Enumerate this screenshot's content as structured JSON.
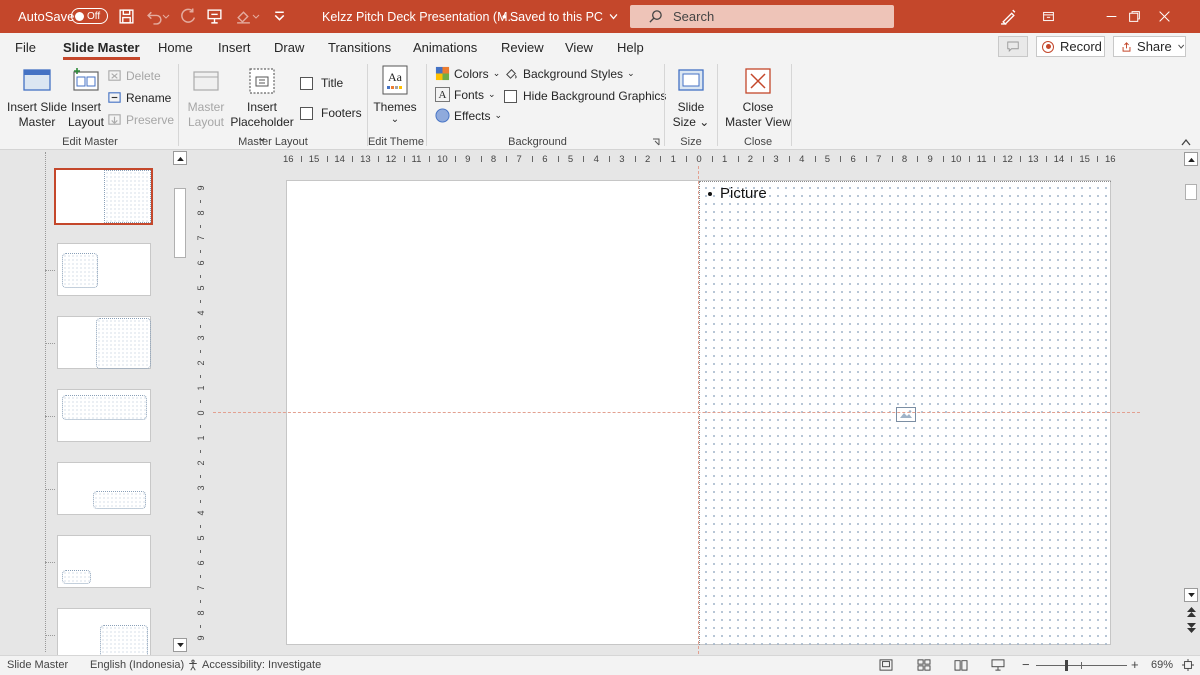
{
  "titlebar": {
    "autosave_label": "AutoSave",
    "autosave_state": "Off",
    "document_title": "Kelzz Pitch Deck Presentation (M...",
    "save_status": "• Saved to this PC",
    "search_placeholder": "Search",
    "accent_color": "#c4472b"
  },
  "tabs": [
    {
      "label": "File"
    },
    {
      "label": "Slide Master",
      "active": true
    },
    {
      "label": "Home"
    },
    {
      "label": "Insert"
    },
    {
      "label": "Draw"
    },
    {
      "label": "Transitions"
    },
    {
      "label": "Animations"
    },
    {
      "label": "Review"
    },
    {
      "label": "View"
    },
    {
      "label": "Help"
    }
  ],
  "actions": {
    "record_label": "Record",
    "share_label": "Share"
  },
  "ribbon": {
    "edit_master": {
      "group_label": "Edit Master",
      "insert_slide_master": [
        "Insert Slide",
        "Master"
      ],
      "insert_layout": [
        "Insert",
        "Layout"
      ],
      "delete_label": "Delete",
      "rename_label": "Rename",
      "preserve_label": "Preserve"
    },
    "master_layout": {
      "group_label": "Master Layout",
      "master_layout_btn": [
        "Master",
        "Layout"
      ],
      "insert_placeholder": [
        "Insert",
        "Placeholder"
      ],
      "title_label": "Title",
      "footers_label": "Footers"
    },
    "edit_theme": {
      "group_label": "Edit Theme",
      "themes_label": "Themes"
    },
    "background": {
      "group_label": "Background",
      "colors_label": "Colors",
      "fonts_label": "Fonts",
      "effects_label": "Effects",
      "background_styles_label": "Background Styles",
      "hide_bg_graphics_label": "Hide Background Graphics"
    },
    "size": {
      "group_label": "Size",
      "slide_size": [
        "Slide",
        "Size"
      ]
    },
    "close": {
      "group_label": "Close",
      "close_master_view": [
        "Close",
        "Master View"
      ]
    }
  },
  "ruler_h_labels": [
    "16",
    "15",
    "14",
    "13",
    "12",
    "11",
    "10",
    "9",
    "8",
    "7",
    "6",
    "5",
    "4",
    "3",
    "2",
    "1",
    "0",
    "1",
    "2",
    "3",
    "4",
    "5",
    "6",
    "7",
    "8",
    "9",
    "10",
    "11",
    "12",
    "13",
    "14",
    "15",
    "16"
  ],
  "ruler_v_labels": [
    "9",
    "8",
    "7",
    "6",
    "5",
    "4",
    "3",
    "2",
    "1",
    "0",
    "1",
    "2",
    "3",
    "4",
    "5",
    "6",
    "7",
    "8",
    "9"
  ],
  "slide": {
    "placeholder_text": "Picture"
  },
  "status": {
    "view_label": "Slide Master",
    "language": "English (Indonesia)",
    "accessibility": "Accessibility: Investigate",
    "zoom_level": "69%"
  }
}
